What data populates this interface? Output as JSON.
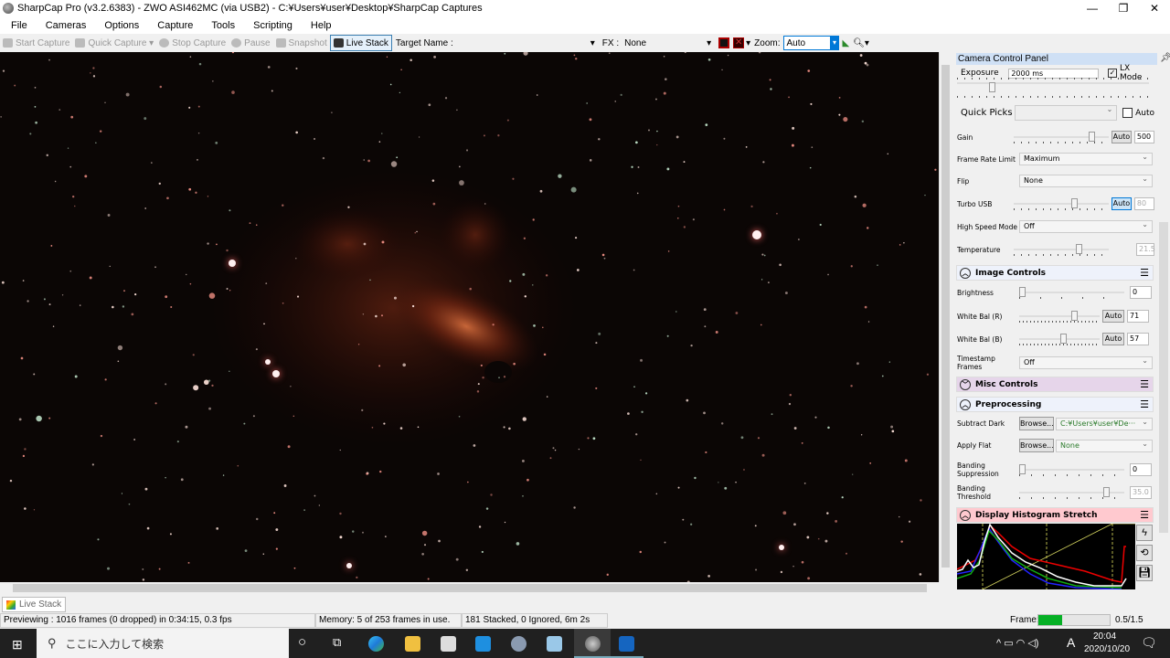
{
  "window": {
    "title": "SharpCap Pro (v3.2.6383) - ZWO ASI462MC (via USB2) - C:¥Users¥user¥Desktop¥SharpCap Captures",
    "min": "—",
    "max": "❐",
    "close": "✕"
  },
  "menu": [
    "File",
    "Cameras",
    "Options",
    "Capture",
    "Tools",
    "Scripting",
    "Help"
  ],
  "toolbar": {
    "start_capture": "Start Capture",
    "quick_capture": "Quick Capture",
    "stop_capture": "Stop Capture",
    "pause": "Pause",
    "snapshot": "Snapshot",
    "live_stack": "Live Stack",
    "target_name_label": "Target Name :",
    "target_name_value": "",
    "fx_label": "FX :",
    "fx_value": "None",
    "zoom_label": "Zoom:",
    "zoom_value": "Auto"
  },
  "panel": {
    "title": "Camera Control Panel",
    "exposure": {
      "label": "Exposure",
      "value": "2000 ms",
      "lx_mode": "LX Mode",
      "lx_checked": true
    },
    "quick_picks": {
      "label": "Quick Picks",
      "value": "",
      "auto": "Auto"
    },
    "gain": {
      "label": "Gain",
      "auto": "Auto",
      "value": "500",
      "level": 0.85
    },
    "frame_rate_limit": {
      "label": "Frame Rate Limit",
      "value": "Maximum"
    },
    "flip": {
      "label": "Flip",
      "value": "None"
    },
    "turbo_usb": {
      "label": "Turbo USB",
      "auto": "Auto",
      "value": "80",
      "level": 0.65
    },
    "high_speed_mode": {
      "label": "High Speed Mode",
      "value": "Off"
    },
    "temperature": {
      "label": "Temperature",
      "value": "21.5",
      "level": 0.7
    },
    "image_controls": {
      "title": "Image Controls",
      "brightness": {
        "label": "Brightness",
        "value": "0",
        "level": 0
      },
      "wb_r": {
        "label": "White Bal (R)",
        "auto": "Auto",
        "value": "71",
        "level": 0.7
      },
      "wb_b": {
        "label": "White Bal (B)",
        "auto": "Auto",
        "value": "57",
        "level": 0.55
      },
      "timestamp": {
        "label": "Timestamp Frames",
        "value": "Off"
      }
    },
    "misc_controls": {
      "title": "Misc Controls"
    },
    "preprocessing": {
      "title": "Preprocessing",
      "subtract_dark": {
        "label": "Subtract Dark",
        "browse": "Browse...",
        "value": "C:¥Users¥user¥De···"
      },
      "apply_flat": {
        "label": "Apply Flat",
        "browse": "Browse...",
        "value": "None"
      },
      "banding_suppression": {
        "label": "Banding Suppression",
        "value": "0",
        "level": 0
      },
      "banding_threshold": {
        "label": "Banding Threshold",
        "value": "35.0",
        "level": 0.85
      }
    },
    "histogram": {
      "title": "Display Histogram Stretch"
    }
  },
  "tab": {
    "live_stack": "Live Stack"
  },
  "status": {
    "preview": "Previewing : 1016 frames (0 dropped) in 0:34:15, 0.3 fps",
    "memory": "Memory: 5 of 253 frames in use.",
    "stacked": "181 Stacked, 0 Ignored, 6m 2s",
    "frame_label": "Frame:",
    "frame_value": "0.5/1.5",
    "frame_progress": 0.33
  },
  "taskbar": {
    "search_placeholder": "ここに入力して検索",
    "time": "20:04",
    "date": "2020/10/20",
    "ime": "A"
  },
  "colors": {
    "accent": "#0078d7",
    "misc_header": "#e6d5ea",
    "hist_header": "#ffc9cf",
    "section_header": "#eef2fb"
  }
}
